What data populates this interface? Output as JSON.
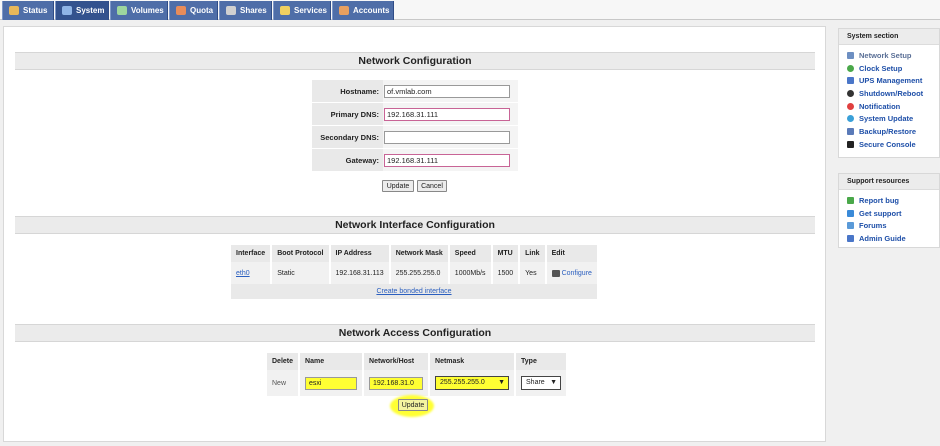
{
  "nav": {
    "tabs": [
      {
        "label": "Status",
        "icon": "status-icon",
        "color": "#e8b85a"
      },
      {
        "label": "System",
        "icon": "system-icon",
        "color": "#8fb4e6"
      },
      {
        "label": "Volumes",
        "icon": "volumes-icon",
        "color": "#9ed69e"
      },
      {
        "label": "Quota",
        "icon": "quota-icon",
        "color": "#e88c5a"
      },
      {
        "label": "Shares",
        "icon": "shares-icon",
        "color": "#d0d0d0"
      },
      {
        "label": "Services",
        "icon": "services-icon",
        "color": "#f0d060"
      },
      {
        "label": "Accounts",
        "icon": "accounts-icon",
        "color": "#e8a060"
      }
    ]
  },
  "network_config": {
    "title": "Network Configuration",
    "hostname_label": "Hostname:",
    "hostname_value": "of.vmlab.com",
    "primary_dns_label": "Primary DNS:",
    "primary_dns_value": "192.168.31.111",
    "secondary_dns_label": "Secondary DNS:",
    "secondary_dns_value": "",
    "gateway_label": "Gateway:",
    "gateway_value": "192.168.31.111",
    "update_label": "Update",
    "cancel_label": "Cancel"
  },
  "interface_config": {
    "title": "Network Interface Configuration",
    "headers": [
      "Interface",
      "Boot Protocol",
      "IP Address",
      "Network Mask",
      "Speed",
      "MTU",
      "Link",
      "Edit"
    ],
    "row": {
      "interface": "eth0",
      "boot_protocol": "Static",
      "ip_address": "192.168.31.113",
      "network_mask": "255.255.255.0",
      "speed": "1000Mb/s",
      "mtu": "1500",
      "link": "Yes",
      "edit": "Configure"
    },
    "bond_link": "Create bonded interface"
  },
  "access_config": {
    "title": "Network Access Configuration",
    "headers": [
      "Delete",
      "Name",
      "Network/Host",
      "Netmask",
      "Type"
    ],
    "row": {
      "delete": "New",
      "name": "esxi",
      "network": "192.168.31.0",
      "netmask": "255.255.255.0",
      "type": "Share"
    },
    "update_label": "Update",
    "highlight_color": "#ffff33"
  },
  "sidebar": {
    "system_title": "System section",
    "system_items": [
      "Network Setup",
      "Clock Setup",
      "UPS Management",
      "Shutdown/Reboot",
      "Notification",
      "System Update",
      "Backup/Restore",
      "Secure Console"
    ],
    "support_title": "Support resources",
    "support_items": [
      "Report bug",
      "Get support",
      "Forums",
      "Admin Guide"
    ]
  }
}
